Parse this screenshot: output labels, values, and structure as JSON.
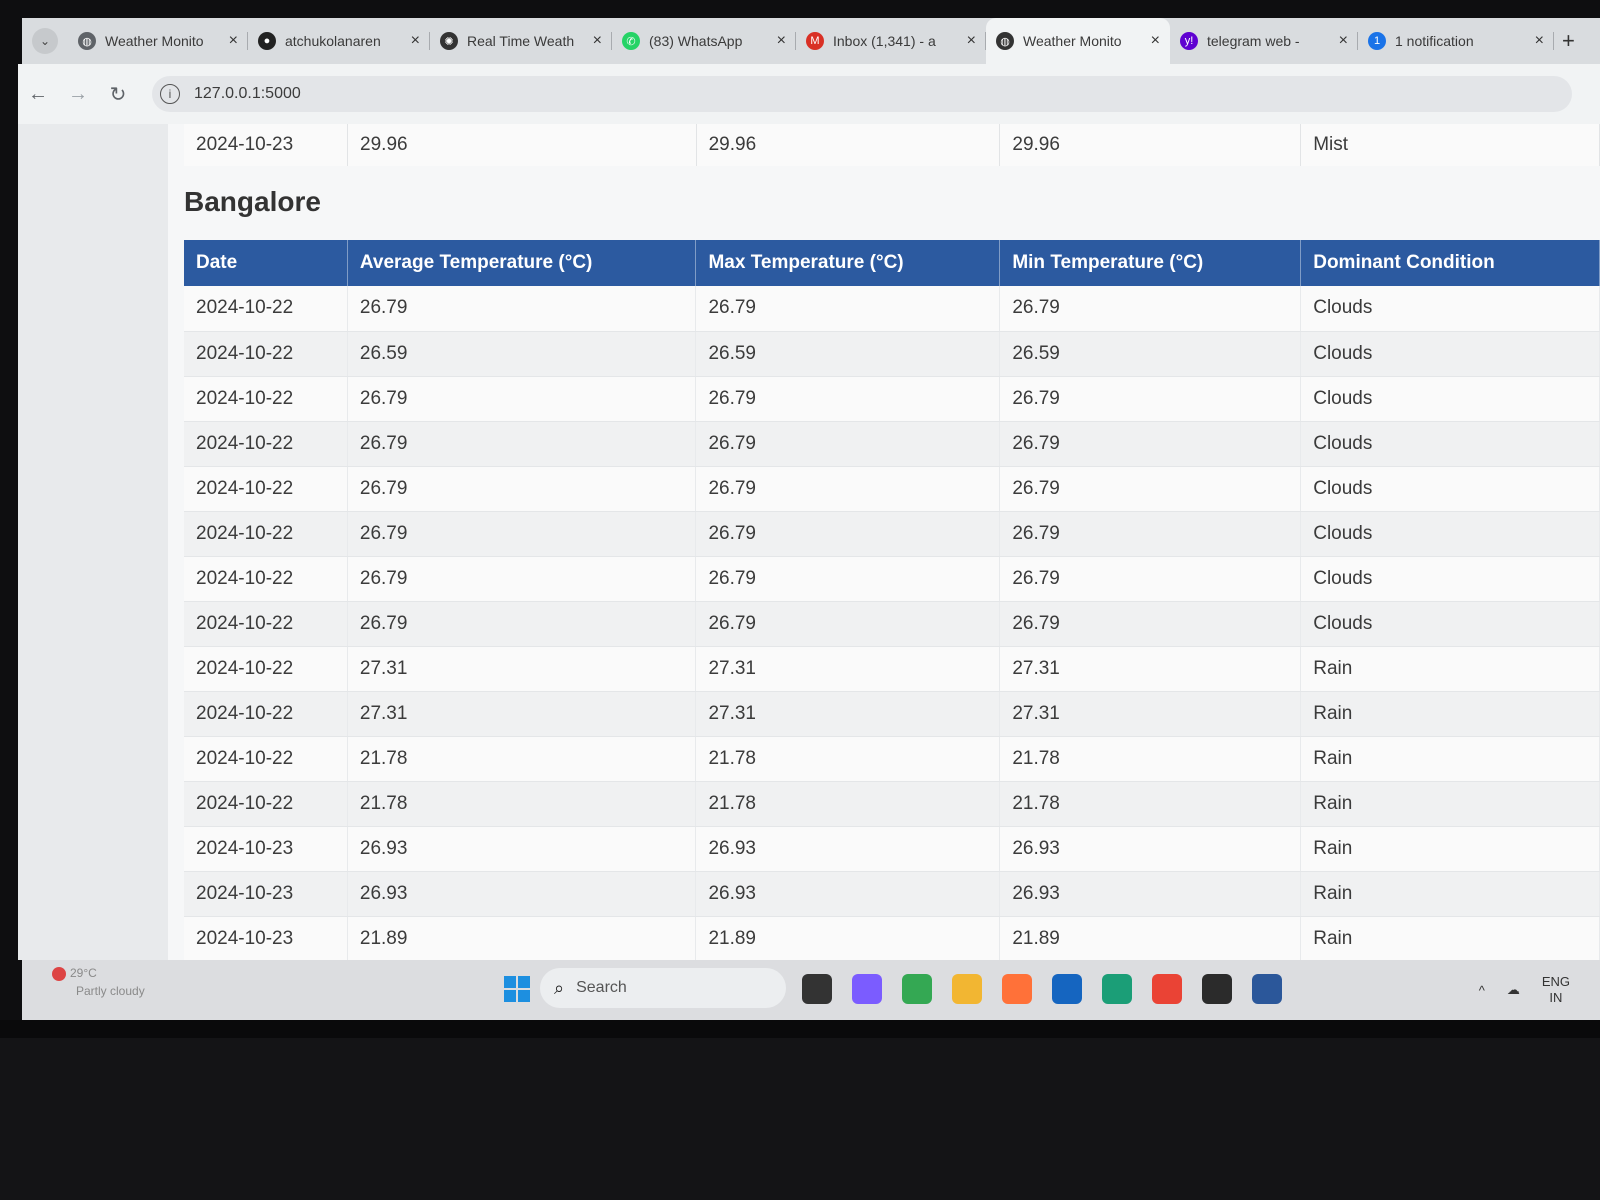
{
  "browser": {
    "tabs": [
      {
        "label": "Weather Monito",
        "icon": "globe-icon",
        "color": "#5f6368"
      },
      {
        "label": "atchukolanaren",
        "icon": "github-icon",
        "color": "#222222"
      },
      {
        "label": "Real Time Weath",
        "icon": "openai-icon",
        "color": "#333333"
      },
      {
        "label": "(83) WhatsApp",
        "icon": "whatsapp-icon",
        "color": "#25d366"
      },
      {
        "label": "Inbox (1,341) - a",
        "icon": "gmail-icon",
        "color": "#d93025"
      },
      {
        "label": "Weather Monito",
        "icon": "globe-icon",
        "color": "#333333",
        "active": true
      },
      {
        "label": "telegram web -",
        "icon": "yahoo-icon",
        "color": "#5f01d1"
      },
      {
        "label": "1 notification",
        "icon": "notification-icon",
        "color": "#1a73e8"
      }
    ],
    "url": "127.0.0.1:5000",
    "accent_color": "#2c5aa0"
  },
  "previous_table_last_row": {
    "date": "2024-10-23",
    "avg": "29.96",
    "max": "29.96",
    "min": "29.96",
    "condition": "Mist"
  },
  "city_heading": "Bangalore",
  "table": {
    "headers": [
      "Date",
      "Average Temperature (°C)",
      "Max Temperature (°C)",
      "Min Temperature (°C)",
      "Dominant Condition"
    ],
    "rows": [
      [
        "2024-10-22",
        "26.79",
        "26.79",
        "26.79",
        "Clouds"
      ],
      [
        "2024-10-22",
        "26.59",
        "26.59",
        "26.59",
        "Clouds"
      ],
      [
        "2024-10-22",
        "26.79",
        "26.79",
        "26.79",
        "Clouds"
      ],
      [
        "2024-10-22",
        "26.79",
        "26.79",
        "26.79",
        "Clouds"
      ],
      [
        "2024-10-22",
        "26.79",
        "26.79",
        "26.79",
        "Clouds"
      ],
      [
        "2024-10-22",
        "26.79",
        "26.79",
        "26.79",
        "Clouds"
      ],
      [
        "2024-10-22",
        "26.79",
        "26.79",
        "26.79",
        "Clouds"
      ],
      [
        "2024-10-22",
        "26.79",
        "26.79",
        "26.79",
        "Clouds"
      ],
      [
        "2024-10-22",
        "27.31",
        "27.31",
        "27.31",
        "Rain"
      ],
      [
        "2024-10-22",
        "27.31",
        "27.31",
        "27.31",
        "Rain"
      ],
      [
        "2024-10-22",
        "21.78",
        "21.78",
        "21.78",
        "Rain"
      ],
      [
        "2024-10-22",
        "21.78",
        "21.78",
        "21.78",
        "Rain"
      ],
      [
        "2024-10-23",
        "26.93",
        "26.93",
        "26.93",
        "Rain"
      ],
      [
        "2024-10-23",
        "26.93",
        "26.93",
        "26.93",
        "Rain"
      ],
      [
        "2024-10-23",
        "21.89",
        "21.89",
        "21.89",
        "Rain"
      ]
    ]
  },
  "taskbar": {
    "weather_temp": "29°C",
    "weather_desc": "Partly cloudy",
    "search_placeholder": "Search",
    "apps": [
      {
        "name": "task-view-icon",
        "color": "#333333"
      },
      {
        "name": "copilot-icon",
        "color": "#7b5cff"
      },
      {
        "name": "chrome-icon",
        "color": "#34a853"
      },
      {
        "name": "file-explorer-icon",
        "color": "#f2b632"
      },
      {
        "name": "firefox-icon",
        "color": "#ff7139"
      },
      {
        "name": "store-icon",
        "color": "#1565c0"
      },
      {
        "name": "edge-icon",
        "color": "#1b9e77"
      },
      {
        "name": "chrome-active-icon",
        "color": "#ea4335"
      },
      {
        "name": "terminal-icon",
        "color": "#2b2b2b"
      },
      {
        "name": "word-icon",
        "color": "#2b579a"
      }
    ],
    "lang_line1": "ENG",
    "lang_line2": "IN"
  }
}
